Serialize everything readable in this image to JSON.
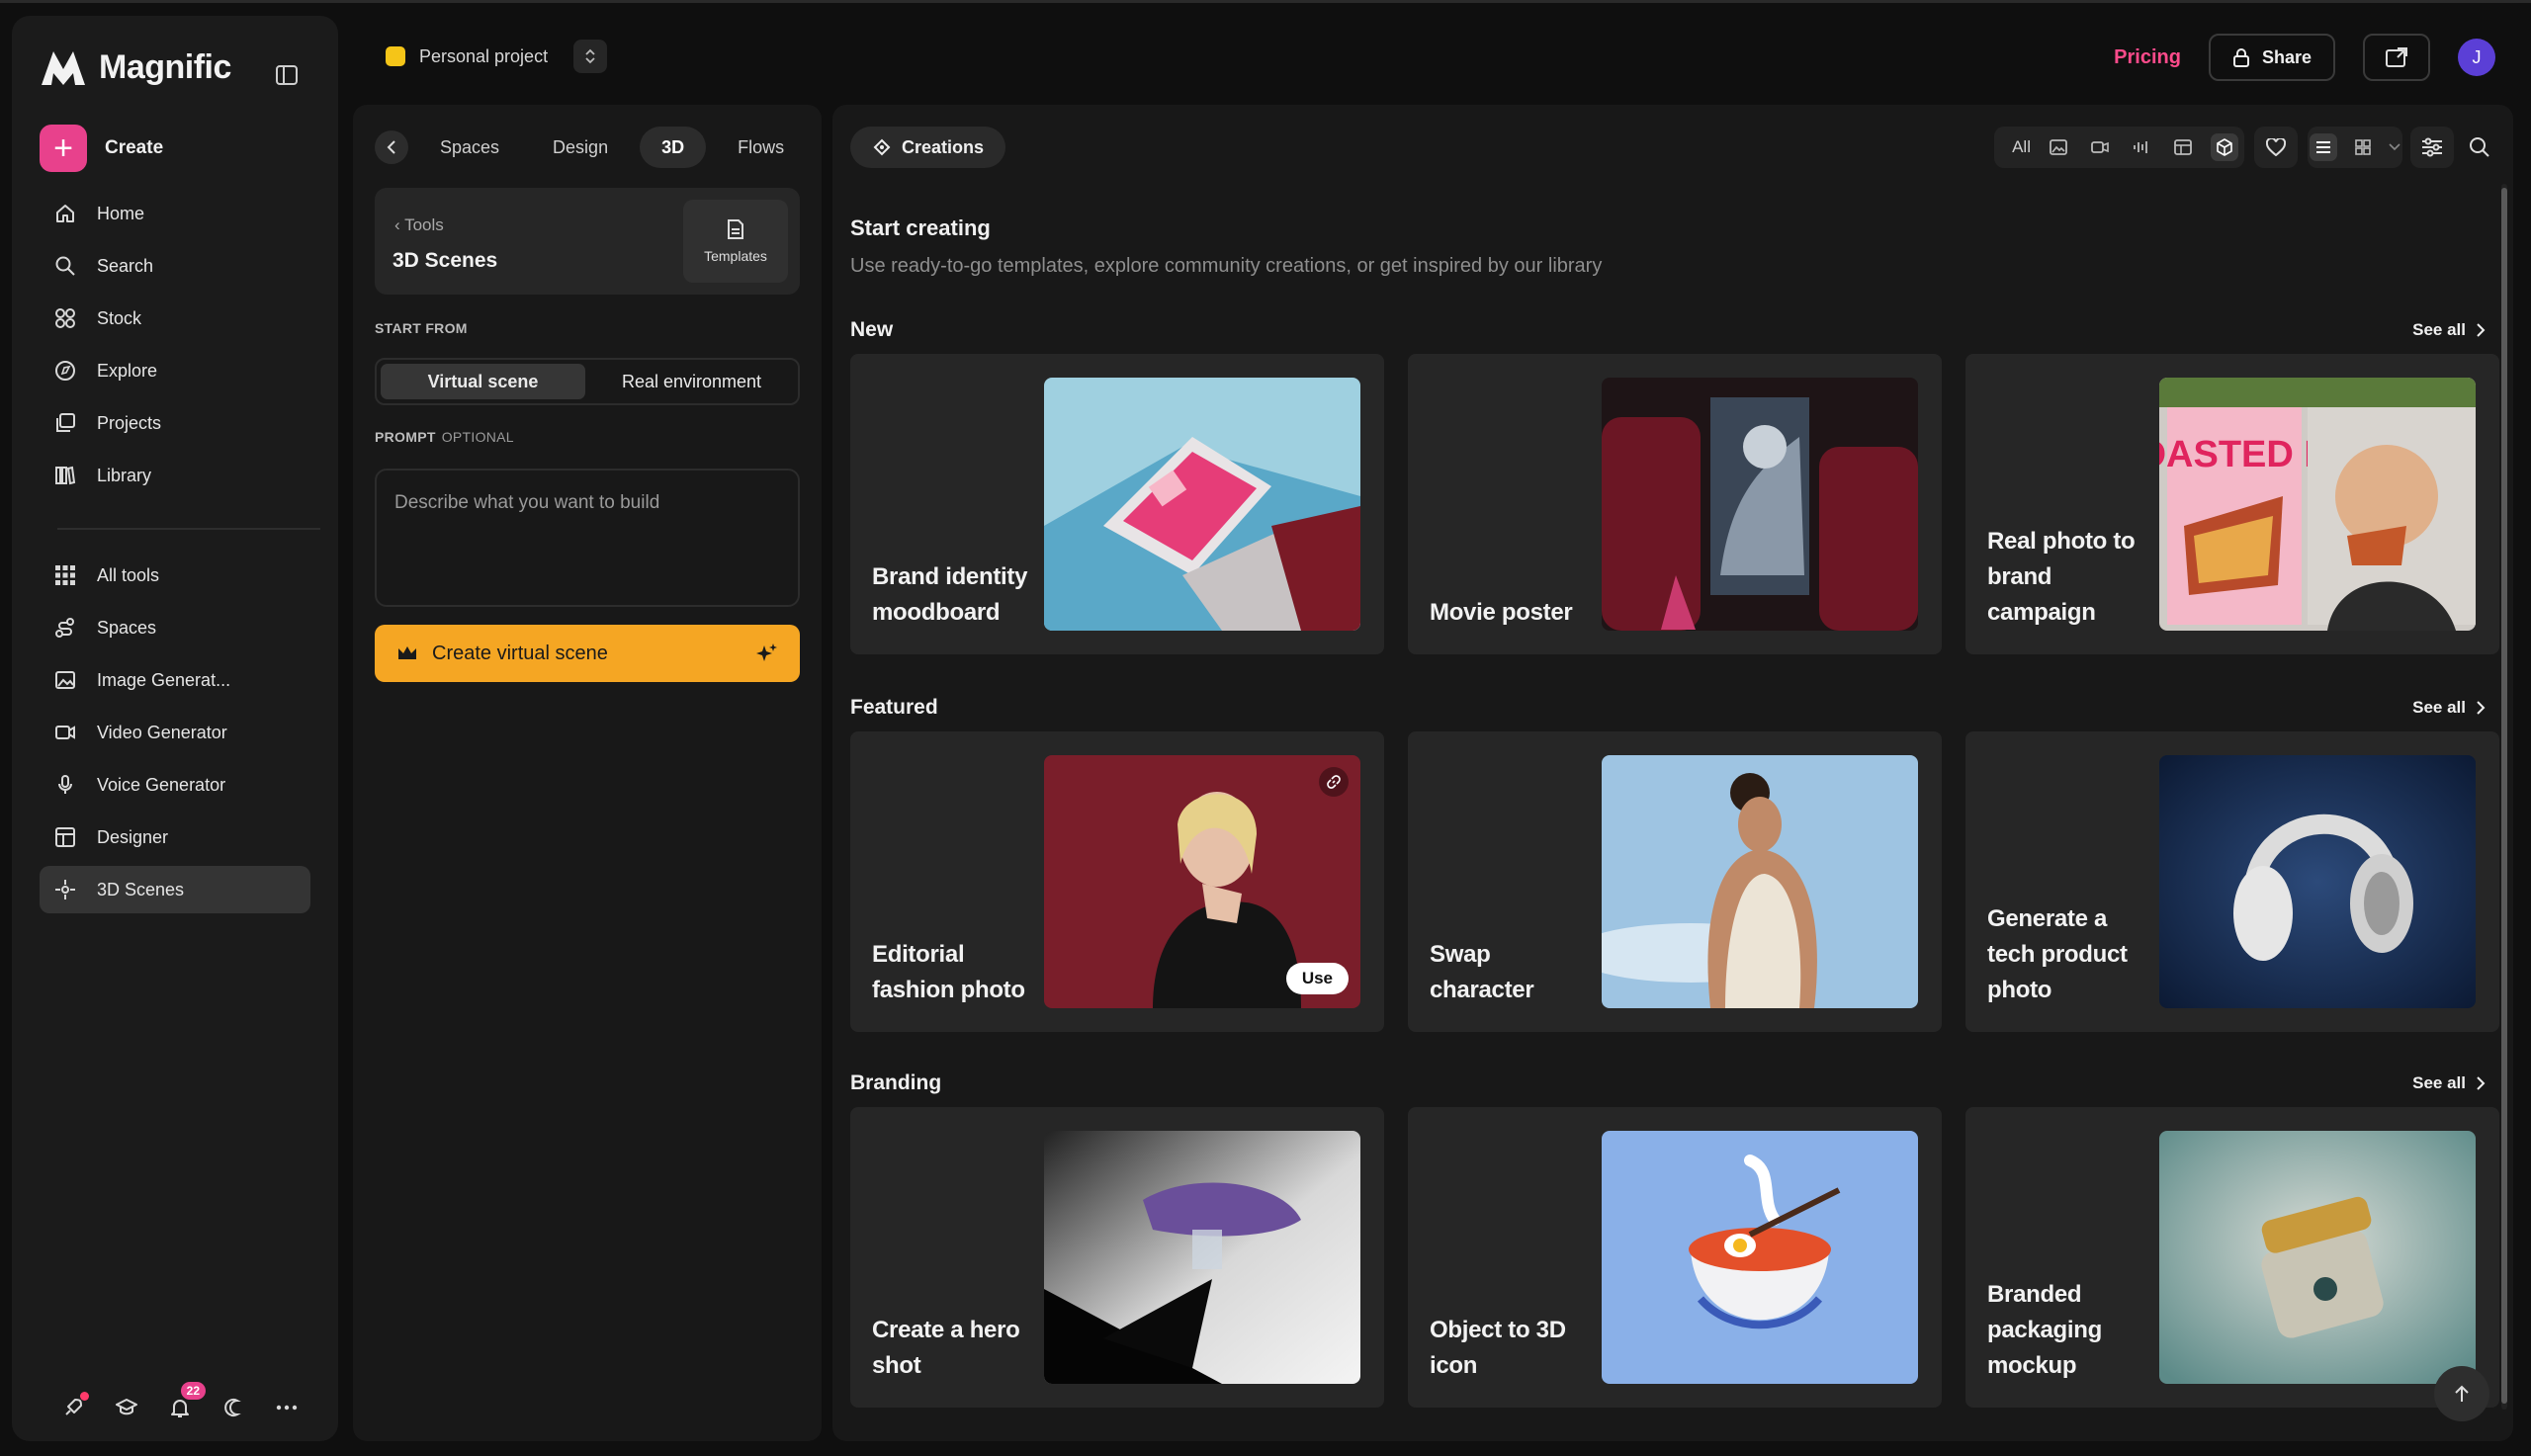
{
  "app": {
    "name": "Magnific"
  },
  "sidebar": {
    "create_label": "Create",
    "nav_top": [
      {
        "label": "Home",
        "icon": "home-icon"
      },
      {
        "label": "Search",
        "icon": "search-icon"
      },
      {
        "label": "Stock",
        "icon": "stock-icon"
      },
      {
        "label": "Explore",
        "icon": "explore-icon"
      },
      {
        "label": "Projects",
        "icon": "projects-icon"
      },
      {
        "label": "Library",
        "icon": "library-icon"
      }
    ],
    "nav_tools": [
      {
        "label": "All tools",
        "icon": "grid-icon"
      },
      {
        "label": "Spaces",
        "icon": "spaces-icon"
      },
      {
        "label": "Image Generat...",
        "icon": "image-icon"
      },
      {
        "label": "Video Generator",
        "icon": "video-icon"
      },
      {
        "label": "Voice Generator",
        "icon": "mic-icon"
      },
      {
        "label": "Designer",
        "icon": "designer-icon"
      },
      {
        "label": "3D Scenes",
        "icon": "3d-icon",
        "active": true
      }
    ],
    "notifications_count": "22"
  },
  "topbar": {
    "project_label": "Personal project",
    "pricing_label": "Pricing",
    "share_label": "Share",
    "avatar_initial": "J"
  },
  "panel": {
    "tabs": [
      "Spaces",
      "Design",
      "3D",
      "Flows"
    ],
    "active_tab": "3D",
    "tool_back_label": "Tools",
    "tool_title": "3D Scenes",
    "templates_label": "Templates",
    "start_from_label": "START FROM",
    "segments": [
      "Virtual scene",
      "Real environment"
    ],
    "prompt_label": "PROMPT",
    "prompt_optional": "OPTIONAL",
    "prompt_placeholder": "Describe what you want to build",
    "cta_label": "Create virtual scene"
  },
  "main": {
    "creations_label": "Creations",
    "filter_all": "All",
    "heading": "Start creating",
    "subheading": "Use ready-to-go templates, explore community creations, or get inspired by our library",
    "see_all": "See all",
    "sections": [
      {
        "title": "New",
        "cards": [
          "Brand identity moodboard",
          "Movie poster",
          "Real photo to brand campaign"
        ]
      },
      {
        "title": "Featured",
        "cards": [
          "Editorial fashion photo",
          "Swap character",
          "Generate a tech product photo"
        ]
      },
      {
        "title": "Branding",
        "cards": [
          "Create a hero shot",
          "Object to 3D icon",
          "Branded packaging mockup"
        ]
      }
    ],
    "use_label": "Use",
    "poster_text": "TOASTED BF"
  }
}
